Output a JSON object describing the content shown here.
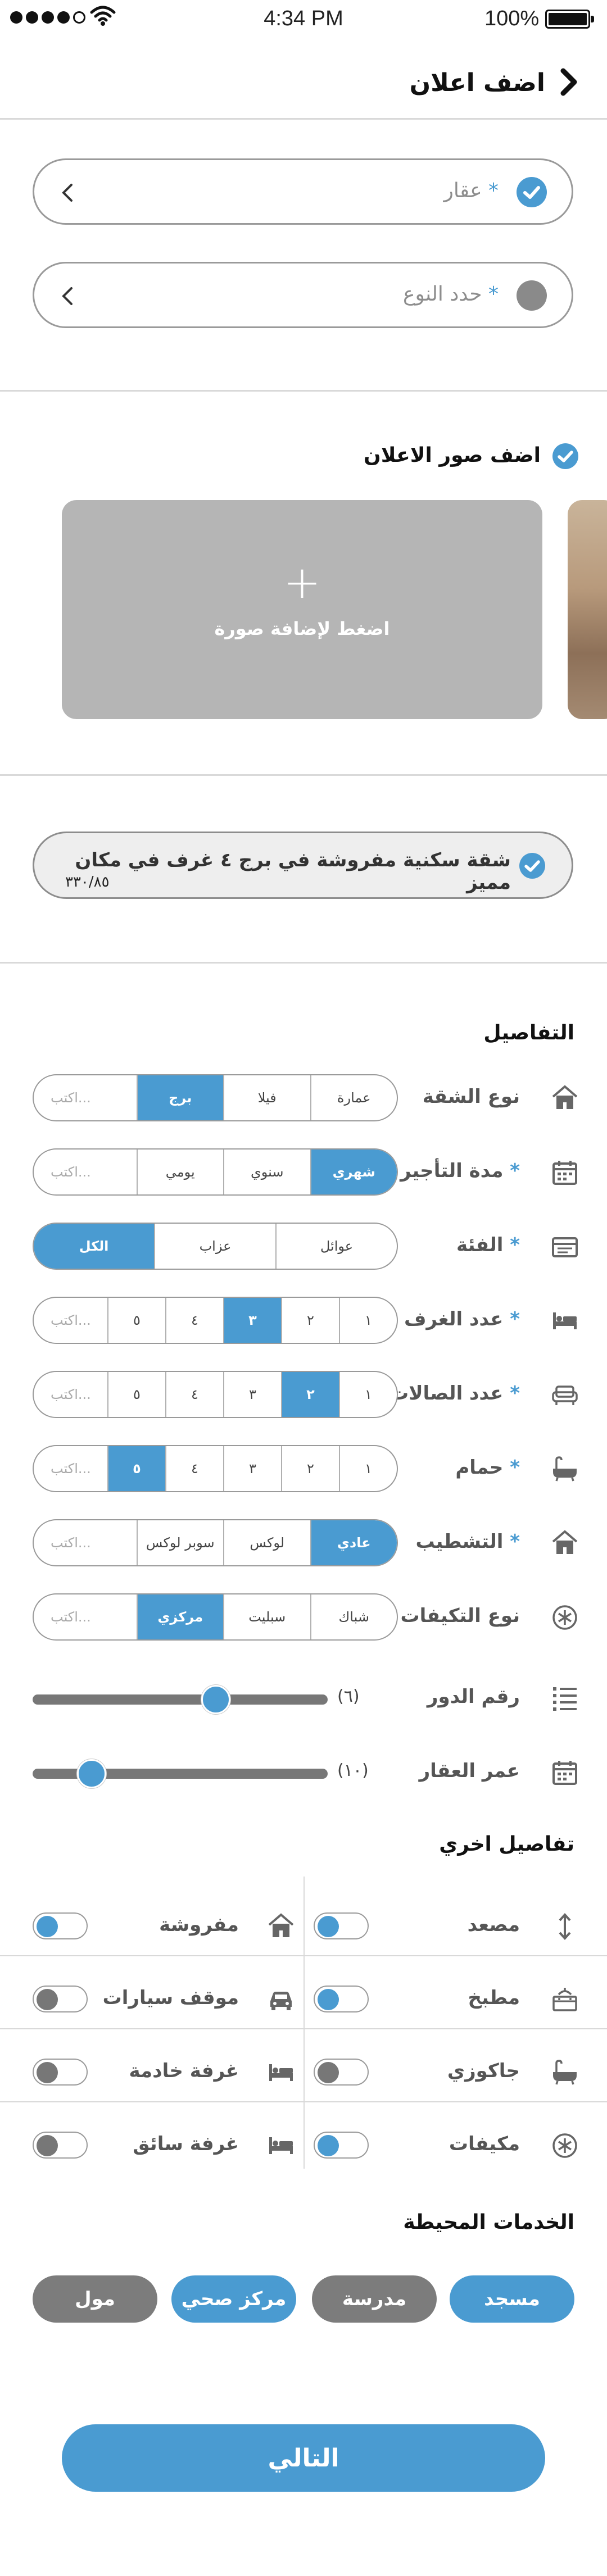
{
  "status_bar": {
    "time": "4:34 PM",
    "battery": "100%"
  },
  "header": {
    "title": "اضف اعلان"
  },
  "pickers": [
    {
      "label": "عقار",
      "required": "*"
    },
    {
      "label": "حدد النوع",
      "required": "*"
    }
  ],
  "photos": {
    "section_title": "اضف صور الاعلان",
    "add_plus": "+",
    "add_caption": "اضغط لإضافة صورة"
  },
  "ad_title": {
    "text": "شقة سكنية مفروشة في برج ٤ غرف في مكان مميز",
    "counter": "٣٣٠/٨٥"
  },
  "details": {
    "section_title": "التفاصيل",
    "rows": [
      {
        "label": "نوع الشقة",
        "required": "",
        "options": [
          "عمارة",
          "فيلا",
          "برج"
        ],
        "selected": 2,
        "input_placeholder": "اكتب..."
      },
      {
        "label": "مدة التأجير",
        "required": "*",
        "options": [
          "شهري",
          "سنوي",
          "يومي"
        ],
        "selected": 0,
        "input_placeholder": "اكتب..."
      },
      {
        "label": "الفئة",
        "required": "*",
        "options": [
          "عوائل",
          "عزاب",
          "الكل"
        ],
        "selected": 2,
        "input_placeholder": ""
      },
      {
        "label": "عدد الغرف",
        "required": "*",
        "options": [
          "١",
          "٢",
          "٣",
          "٤",
          "٥"
        ],
        "selected": 2,
        "input_placeholder": "اكتب..."
      },
      {
        "label": "عدد الصالات",
        "required": "*",
        "options": [
          "١",
          "٢",
          "٣",
          "٤",
          "٥"
        ],
        "selected": 1,
        "input_placeholder": "اكتب..."
      },
      {
        "label": "حمام",
        "required": "*",
        "options": [
          "١",
          "٢",
          "٣",
          "٤",
          "٥"
        ],
        "selected": 4,
        "input_placeholder": "اكتب..."
      },
      {
        "label": "التشطيب",
        "required": "*",
        "options": [
          "عادي",
          "لوكس",
          "سوبر لوكس"
        ],
        "selected": 0,
        "input_placeholder": "اكتب..."
      },
      {
        "label": "نوع التكيفات",
        "required": "",
        "options": [
          "شباك",
          "سبليت",
          "مركزي"
        ],
        "selected": 2,
        "input_placeholder": "اكتب..."
      }
    ],
    "sliders": [
      {
        "label": "رقم الدور",
        "value_text": "(٦)",
        "fraction": 0.62
      },
      {
        "label": "عمر العقار",
        "value_text": "(١٠)",
        "fraction": 0.2
      }
    ]
  },
  "other_details": {
    "section_title": "تفاصيل اخري",
    "right": [
      {
        "label": "مصعد",
        "on": true,
        "icon": "elevator-icon"
      },
      {
        "label": "مطبخ",
        "on": true,
        "icon": "kitchen-icon"
      },
      {
        "label": "جاكوزي",
        "on": false,
        "icon": "bathtub-icon"
      },
      {
        "label": "مكيفات",
        "on": true,
        "icon": "ac-icon"
      }
    ],
    "left": [
      {
        "label": "مفروشة",
        "on": true,
        "icon": "home-icon"
      },
      {
        "label": "موقف سيارات",
        "on": false,
        "icon": "car-icon"
      },
      {
        "label": "غرفة خادمة",
        "on": false,
        "icon": "bed-icon"
      },
      {
        "label": "غرفة سائق",
        "on": false,
        "icon": "bed-icon"
      }
    ]
  },
  "services": {
    "section_title": "الخدمات المحيطة",
    "items": [
      {
        "label": "مسجد",
        "on": true
      },
      {
        "label": "مدرسة",
        "on": false
      },
      {
        "label": "مركز صحي",
        "on": true
      },
      {
        "label": "مول",
        "on": false
      }
    ]
  },
  "next_button": "التالي",
  "colors": {
    "accent": "#4a9bd1",
    "inactive": "#7c7c7c"
  }
}
